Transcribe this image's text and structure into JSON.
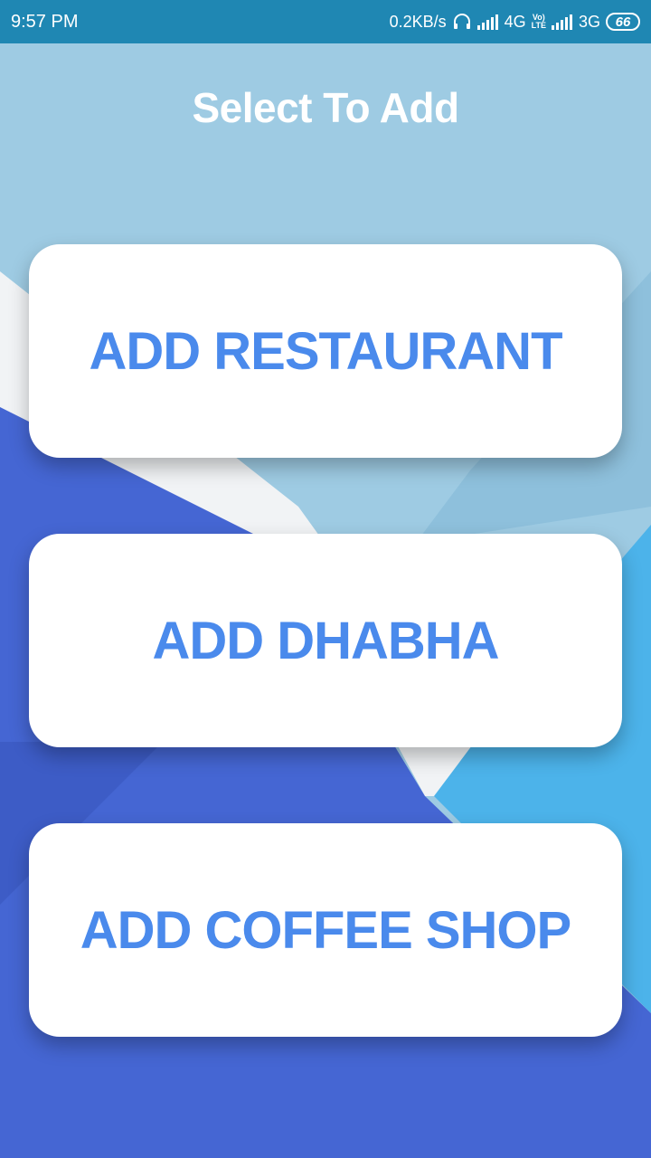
{
  "status_bar": {
    "time": "9:57 PM",
    "net_speed": "0.2KB/s",
    "network_1": "4G",
    "network_2": "3G",
    "volte_top": "Vo)",
    "volte_bottom": "LTE",
    "battery": "66"
  },
  "header": {
    "title": "Select To Add"
  },
  "options": {
    "restaurant": "ADD RESTAURANT",
    "dhabha": "ADD DHABHA",
    "coffee_shop": "ADD COFFEE SHOP"
  },
  "colors": {
    "status_bar": "#1f87b3",
    "background_light": "#9ecbe3",
    "background_blue": "#4566d3",
    "background_cyan": "#4cb3ea",
    "button_text": "#4a8aec"
  },
  "icons": {
    "headset": "headset-icon",
    "signal": "signal-icon"
  }
}
